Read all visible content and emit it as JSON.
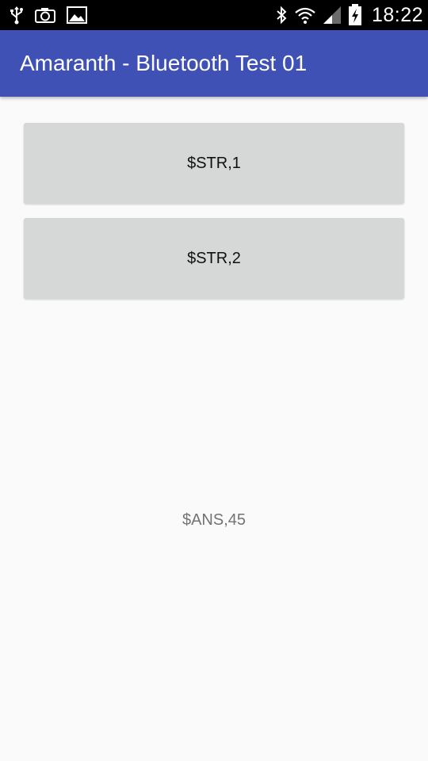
{
  "status_bar": {
    "time": "18:22",
    "left_icons": [
      "usb-icon",
      "camera-icon",
      "image-icon"
    ],
    "right_icons": [
      "bluetooth-icon",
      "wifi-icon",
      "signal-icon",
      "battery-charging-icon"
    ]
  },
  "app_bar": {
    "title": "Amaranth - Bluetooth Test 01",
    "color": "#3f51b5"
  },
  "buttons": [
    {
      "label": "$STR,1"
    },
    {
      "label": "$STR,2"
    }
  ],
  "answer": {
    "text": "$ANS,45"
  }
}
